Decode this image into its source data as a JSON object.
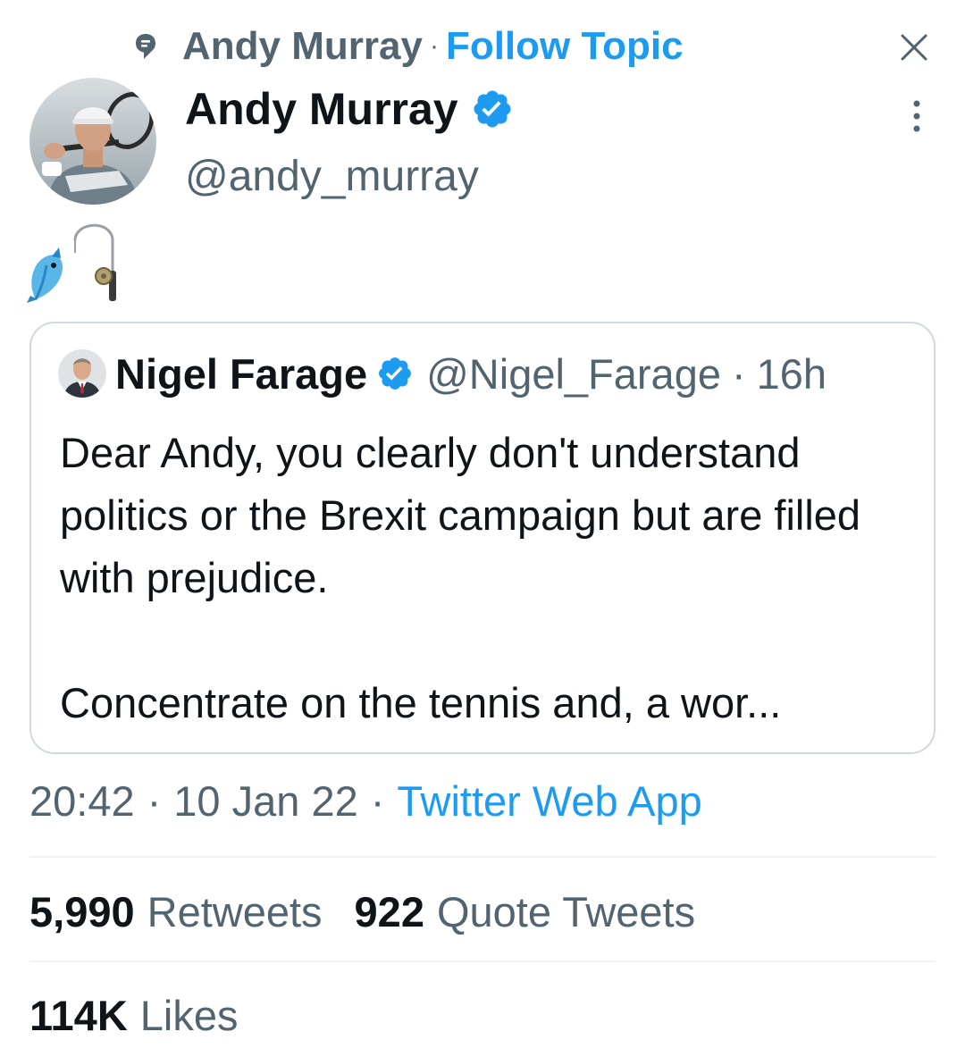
{
  "topic": {
    "name": "Andy Murray",
    "separator": "·",
    "follow_label": "Follow Topic",
    "icon": "topic-speech-bubble-icon"
  },
  "tweet": {
    "author": {
      "name": "Andy Murray",
      "handle": "@andy_murray",
      "verified": true
    },
    "body_emoji": [
      "fish-icon",
      "fishing-rod-icon"
    ],
    "quoted": {
      "author": {
        "name": "Nigel Farage",
        "handle": "@Nigel_Farage",
        "verified": true
      },
      "separator": "·",
      "time": "16h",
      "text_lines": [
        "Dear Andy, you clearly don't understand politics or the Brexit campaign but are filled with prejudice.",
        "Concentrate on the tennis and, a wor..."
      ]
    },
    "meta": {
      "time": "20:42",
      "separator": "·",
      "date": "10 Jan 22",
      "separator2": "·",
      "source": "Twitter Web App"
    },
    "stats": {
      "retweets_count": "5,990",
      "retweets_label": "Retweets",
      "quotes_count": "922",
      "quotes_label": "Quote Tweets",
      "likes_count": "114K",
      "likes_label": "Likes"
    }
  },
  "colors": {
    "accent": "#1d9bf0",
    "text_primary": "#0f1419",
    "text_secondary": "#536471",
    "border": "#cfd9de",
    "divider": "#eff3f4"
  }
}
